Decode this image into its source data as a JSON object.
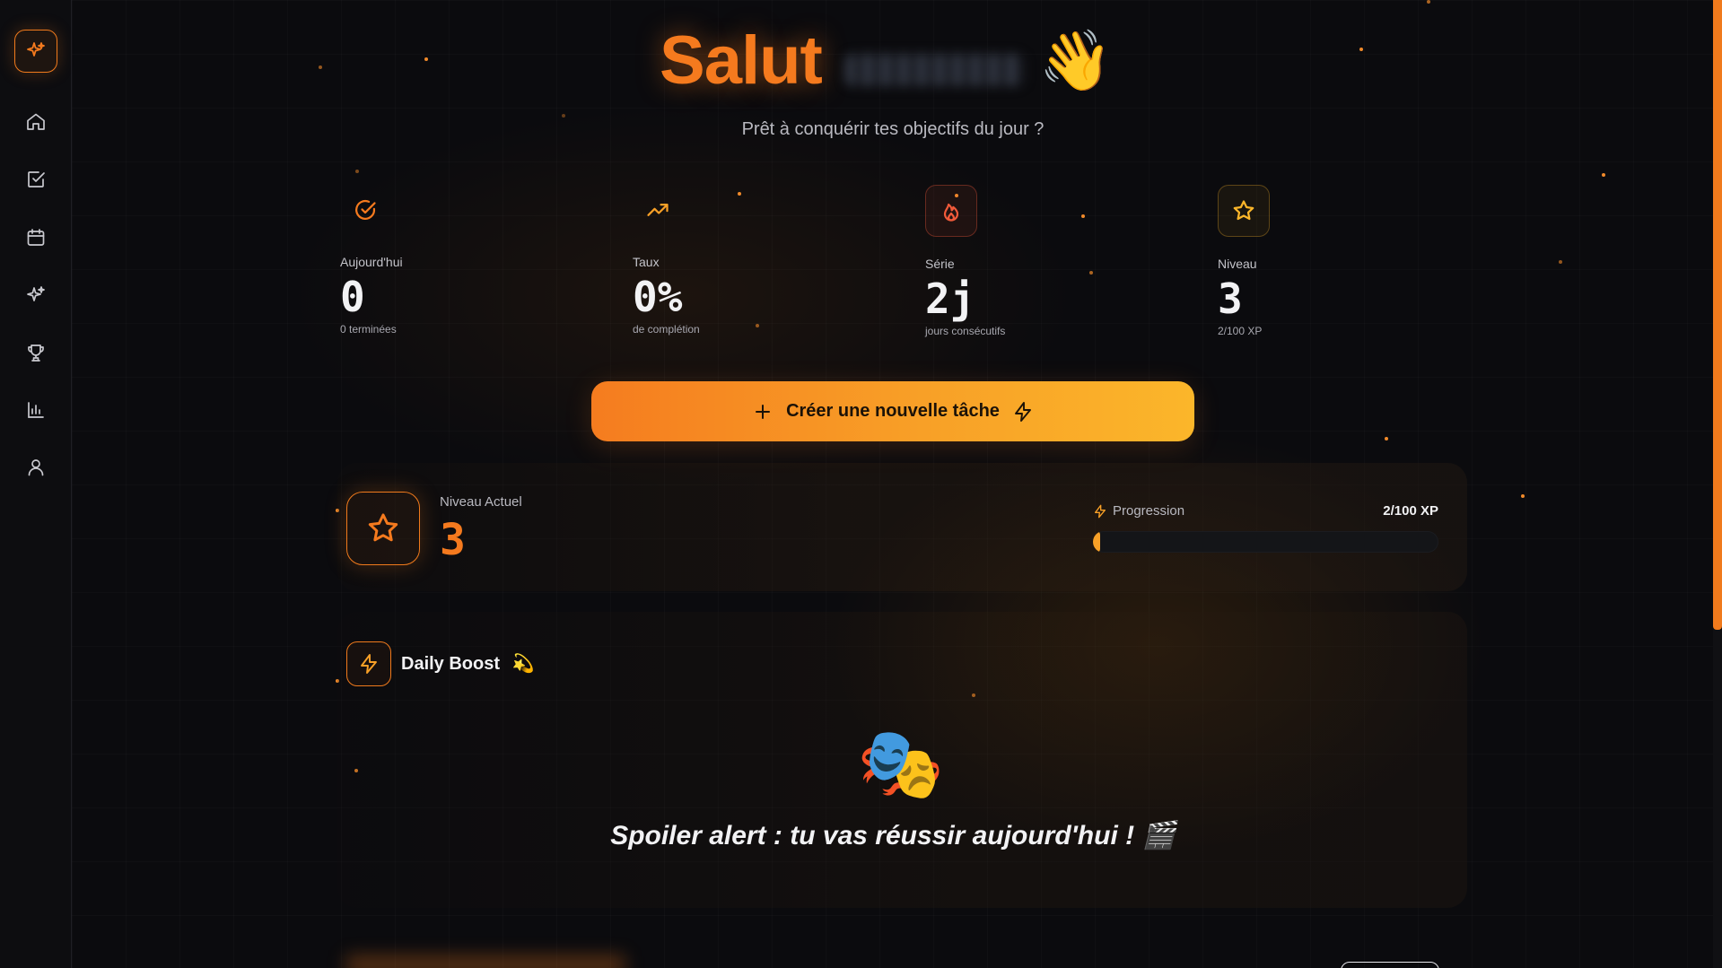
{
  "header": {
    "greeting": "Salut",
    "wave_emoji": "👋",
    "subtitle": "Prêt à conquérir tes objectifs du jour ?"
  },
  "sidebar": {
    "items": [
      {
        "name": "home-icon"
      },
      {
        "name": "check-square-icon"
      },
      {
        "name": "calendar-icon"
      },
      {
        "name": "sparkles-icon"
      },
      {
        "name": "trophy-icon"
      },
      {
        "name": "bar-chart-icon"
      },
      {
        "name": "user-icon"
      }
    ]
  },
  "stats": [
    {
      "label": "Aujourd'hui",
      "value": "0",
      "sub": "0 terminées",
      "icon": "check-circle-icon"
    },
    {
      "label": "Taux",
      "value": "0%",
      "sub": "de complétion",
      "icon": "trending-up-icon"
    },
    {
      "label": "Série",
      "value": "2j",
      "sub": "jours consécutifs",
      "icon": "flame-icon"
    },
    {
      "label": "Niveau",
      "value": "3",
      "sub": "2/100 XP",
      "icon": "star-icon"
    }
  ],
  "cta": {
    "label": "Créer une nouvelle tâche"
  },
  "level": {
    "label": "Niveau Actuel",
    "value": "3",
    "progress_label": "Progression",
    "progress_value": "2/100 XP",
    "progress_fraction": 0.02
  },
  "boost": {
    "title": "Daily Boost",
    "title_emoji": "💫",
    "emoji": "🎭",
    "quote": "Spoiler alert : tu vas réussir aujourd'hui ! 🎬"
  },
  "colors": {
    "accent": "#f57a1e",
    "accent_yellow": "#fbb62a",
    "flame": "#f05a3a",
    "background": "#0b0b0e"
  }
}
